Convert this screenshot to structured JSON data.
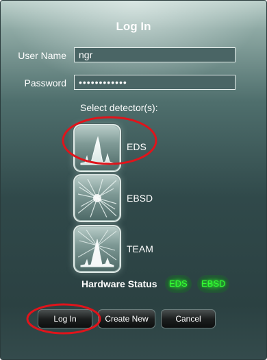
{
  "dialog": {
    "title": "Log In",
    "username": {
      "label": "User Name",
      "value": "ngr"
    },
    "password": {
      "label": "Password",
      "masked_value": "••••••••••••"
    },
    "select_label": "Select detector(s):",
    "detectors": [
      {
        "label": "EDS",
        "icon": "eds-spectrum-icon",
        "selected": true
      },
      {
        "label": "EBSD",
        "icon": "ebsd-pattern-icon",
        "selected": false
      },
      {
        "label": "TEAM",
        "icon": "team-combined-icon",
        "selected": false
      }
    ],
    "hardware_status": {
      "label": "Hardware Status",
      "items": [
        {
          "label": "EDS",
          "color": "#33ff33"
        },
        {
          "label": "EBSD",
          "color": "#33ff33"
        }
      ]
    },
    "buttons": {
      "login": "Log In",
      "create_new": "Create New",
      "cancel": "Cancel"
    }
  },
  "colors": {
    "annotation_circle": "#e0141b",
    "status_ok": "#33ff33"
  }
}
